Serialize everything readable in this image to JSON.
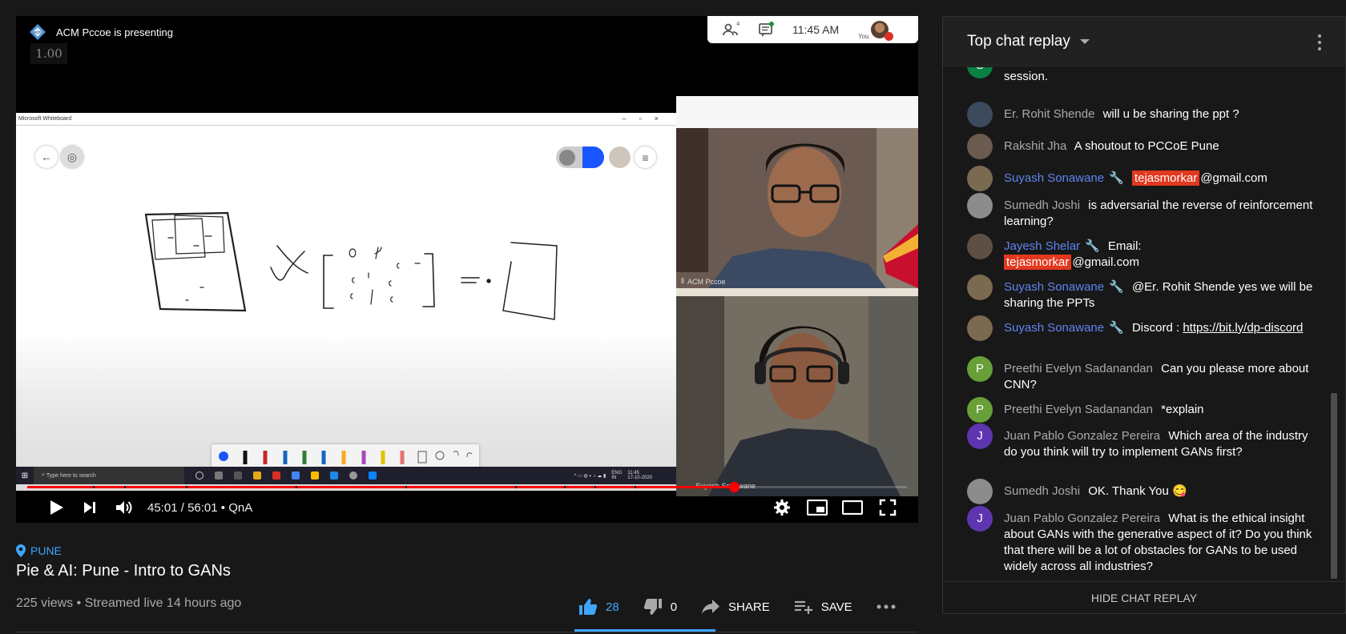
{
  "player": {
    "presenter_text": "ACM Pccoe is presenting",
    "zoom_badge": "1.00",
    "meet_clock": "11:45 AM",
    "meet_people_count": "4",
    "meet_you_label": "You",
    "whiteboard_title": "Microsoft Whiteboard",
    "taskbar_search_placeholder": "Type here to search",
    "taskbar_lang": "ENG",
    "taskbar_lang2": "IN",
    "taskbar_time": "11:45",
    "taskbar_date": "17-10-2020",
    "cam_top_label": "ACM Pccoe",
    "cam_bottom_label": "Suyash Sonawane",
    "current_time": "45:01",
    "duration": "56:01",
    "chapter": "QnA",
    "progress_fraction": 0.8035,
    "chapter_gaps": [
      0.075,
      0.11,
      0.18,
      0.305,
      0.43,
      0.555,
      0.61,
      0.645,
      0.69
    ]
  },
  "video": {
    "location": "PUNE",
    "title": "Pie & AI: Pune - Intro to GANs",
    "views": "225 views",
    "streamed": "Streamed live 14 hours ago",
    "likes": "28",
    "dislikes": "0",
    "share_label": "SHARE",
    "save_label": "SAVE"
  },
  "chat": {
    "header": "Top chat replay",
    "hide_label": "HIDE CHAT REPLAY",
    "messages": [
      {
        "author": "",
        "text": "session.",
        "avatar_letter": "S",
        "avatar_color": "#0b8043"
      },
      {
        "author": "Er. Rohit Shende",
        "text": "will u be sharing the ppt ?",
        "avatar_color": "#3b4a5c"
      },
      {
        "author": "Rakshit Jha",
        "text": "A shoutout to PCCoE Pune",
        "avatar_color": "#6b5a4e"
      },
      {
        "author": "Suyash Sonawane",
        "owner": true,
        "highlight": "tejasmorkar",
        "text": "@gmail.com",
        "avatar_color": "#7a6a50"
      },
      {
        "author": "Sumedh Joshi",
        "text": "is adversarial the reverse of reinforcement learning?",
        "avatar_color": "#8c8c8c"
      },
      {
        "author": "Jayesh Shelar",
        "owner": true,
        "text": "Email:",
        "highlight": "tejasmorkar",
        "text2": "@gmail.com",
        "avatar_color": "#5d4f44"
      },
      {
        "author": "Suyash Sonawane",
        "owner": true,
        "text": "@Er. Rohit Shende yes we will be sharing the PPTs",
        "avatar_color": "#7a6a50"
      },
      {
        "author": "Suyash Sonawane",
        "owner": true,
        "text": "Discord :",
        "link": "https://bit.ly/dp-discord",
        "avatar_color": "#7a6a50"
      },
      {
        "author": "Preethi Evelyn Sadanandan",
        "text": "Can you please more about CNN?",
        "avatar_letter": "P",
        "avatar_color": "#689f38"
      },
      {
        "author": "Preethi Evelyn Sadanandan",
        "text": "*explain",
        "avatar_letter": "P",
        "avatar_color": "#689f38"
      },
      {
        "author": "Juan Pablo Gonzalez Pereira",
        "text": "Which area of the industry do you think will try to implement GANs first?",
        "avatar_letter": "J",
        "avatar_color": "#5e35b1"
      },
      {
        "author": "Sumedh Joshi",
        "text": "OK. Thank You",
        "emoji": "😋",
        "avatar_color": "#8c8c8c"
      },
      {
        "author": "Juan Pablo Gonzalez Pereira",
        "text": "What is the ethical insight about GANs with the generative aspect of it? Do you think that there will be a lot of obstacles for GANs to be used widely across all industries?",
        "avatar_letter": "J",
        "avatar_color": "#5e35b1"
      }
    ]
  },
  "icons": [
    "location-pin-icon",
    "play-icon",
    "next-icon",
    "volume-icon",
    "settings-gear-icon",
    "miniplayer-icon",
    "theater-mode-icon",
    "fullscreen-icon",
    "thumb-up-icon",
    "thumb-down-icon",
    "share-arrow-icon",
    "add-to-playlist-icon",
    "more-horizontal-icon",
    "dropdown-caret-icon",
    "kebab-menu-icon",
    "wrench-icon",
    "people-icon",
    "chat-bubble-icon"
  ],
  "colors": {
    "accent_blue": "#3ea6ff",
    "progress_red": "#ff0000",
    "owner_blue": "#5e84f1",
    "highlight_red": "#e2381e"
  }
}
